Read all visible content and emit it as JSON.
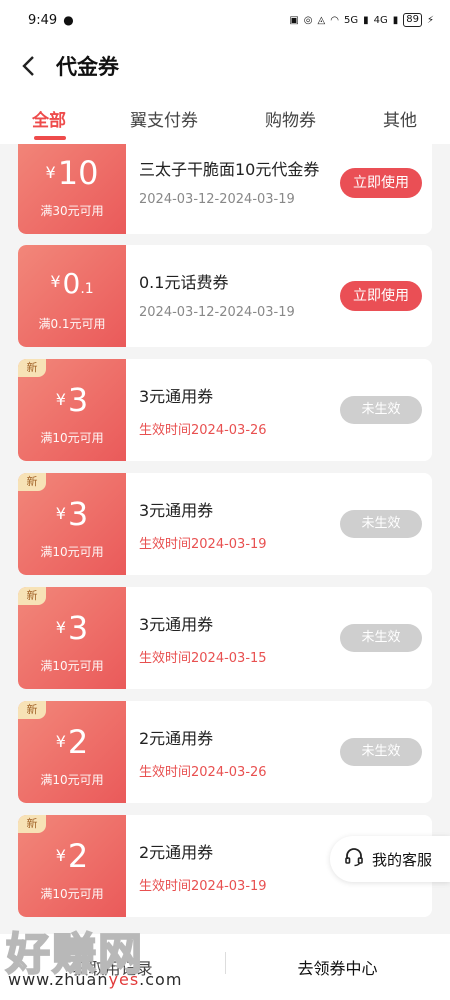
{
  "status": {
    "time": "9:49",
    "battery": "89",
    "signal_labels": [
      "5G",
      "4G"
    ]
  },
  "header": {
    "title": "代金券"
  },
  "tabs": [
    {
      "label": "全部",
      "active": true
    },
    {
      "label": "翼支付券",
      "active": false
    },
    {
      "label": "购物券",
      "active": false
    },
    {
      "label": "其他",
      "active": false
    }
  ],
  "coupons": [
    {
      "yen": "¥",
      "amount": "10",
      "condition": "满30元可用",
      "is_new": false,
      "name": "三太子干脆面10元代金券",
      "date": "2024-03-12-2024-03-19",
      "action": "立即使用",
      "active": true
    },
    {
      "yen": "¥",
      "amount": "0",
      "amount_suffix": ".1",
      "condition": "满0.1元可用",
      "is_new": false,
      "name": "0.1元话费券",
      "date": "2024-03-12-2024-03-19",
      "action": "立即使用",
      "active": true
    },
    {
      "yen": "¥",
      "amount": "3",
      "condition": "满10元可用",
      "is_new": true,
      "new_label": "新",
      "name": "3元通用券",
      "date": "生效时间2024-03-26",
      "action": "未生效",
      "active": false
    },
    {
      "yen": "¥",
      "amount": "3",
      "condition": "满10元可用",
      "is_new": true,
      "new_label": "新",
      "name": "3元通用券",
      "date": "生效时间2024-03-19",
      "action": "未生效",
      "active": false
    },
    {
      "yen": "¥",
      "amount": "3",
      "condition": "满10元可用",
      "is_new": true,
      "new_label": "新",
      "name": "3元通用券",
      "date": "生效时间2024-03-15",
      "action": "未生效",
      "active": false
    },
    {
      "yen": "¥",
      "amount": "2",
      "condition": "满10元可用",
      "is_new": true,
      "new_label": "新",
      "name": "2元通用券",
      "date": "生效时间2024-03-26",
      "action": "未生效",
      "active": false
    },
    {
      "yen": "¥",
      "amount": "2",
      "condition": "满10元可用",
      "is_new": true,
      "new_label": "新",
      "name": "2元通用券",
      "date": "生效时间2024-03-19",
      "action": "",
      "active": false
    }
  ],
  "service": {
    "label": "我的客服"
  },
  "bottom": {
    "left_label": "获取用记录",
    "right_label": "去领券中心"
  },
  "watermark": {
    "main": "好赚网",
    "sub_a": "www.zhuan",
    "sub_b": "yes",
    "sub_c": ".com"
  },
  "colors": {
    "accent": "#ee4b4b",
    "use_button": "#ea4f55",
    "inactive_button": "#cfcfcf"
  }
}
